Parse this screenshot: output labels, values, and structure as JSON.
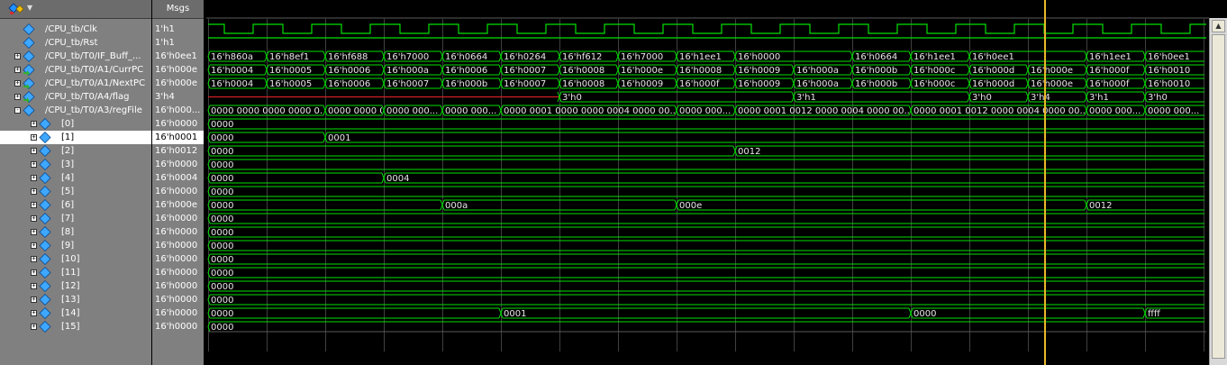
{
  "header": {
    "values_title": "Msgs"
  },
  "signals": [
    {
      "name": "/CPU_tb/Clk",
      "value": "1'h1",
      "indent": 0,
      "expander": "",
      "icon": "input"
    },
    {
      "name": "/CPU_tb/Rst",
      "value": "1'h1",
      "indent": 0,
      "expander": "",
      "icon": "input"
    },
    {
      "name": "/CPU_tb/T0/IF_Buff_...",
      "value": "16'h0ee1",
      "indent": 0,
      "expander": "+",
      "icon": "signal"
    },
    {
      "name": "/CPU_tb/T0/A1/CurrPC",
      "value": "16'h000e",
      "indent": 0,
      "expander": "+",
      "icon": "output"
    },
    {
      "name": "/CPU_tb/T0/A1/NextPC",
      "value": "16'h000e",
      "indent": 0,
      "expander": "+",
      "icon": "output"
    },
    {
      "name": "/CPU_tb/T0/A4/flag",
      "value": "3'h4",
      "indent": 0,
      "expander": "+",
      "icon": "output"
    },
    {
      "name": "/CPU_tb/T0/A3/regFile",
      "value": "16'h000...",
      "indent": 0,
      "expander": "-",
      "icon": "signal"
    },
    {
      "name": "[0]",
      "value": "16'h0000",
      "indent": 1,
      "expander": "+",
      "icon": "signal"
    },
    {
      "name": "[1]",
      "value": "16'h0001",
      "indent": 1,
      "expander": "+",
      "icon": "signal",
      "selected": true
    },
    {
      "name": "[2]",
      "value": "16'h0012",
      "indent": 1,
      "expander": "+",
      "icon": "signal"
    },
    {
      "name": "[3]",
      "value": "16'h0000",
      "indent": 1,
      "expander": "+",
      "icon": "signal"
    },
    {
      "name": "[4]",
      "value": "16'h0004",
      "indent": 1,
      "expander": "+",
      "icon": "signal"
    },
    {
      "name": "[5]",
      "value": "16'h0000",
      "indent": 1,
      "expander": "+",
      "icon": "signal"
    },
    {
      "name": "[6]",
      "value": "16'h000e",
      "indent": 1,
      "expander": "+",
      "icon": "signal"
    },
    {
      "name": "[7]",
      "value": "16'h0000",
      "indent": 1,
      "expander": "+",
      "icon": "signal"
    },
    {
      "name": "[8]",
      "value": "16'h0000",
      "indent": 1,
      "expander": "+",
      "icon": "signal"
    },
    {
      "name": "[9]",
      "value": "16'h0000",
      "indent": 1,
      "expander": "+",
      "icon": "signal"
    },
    {
      "name": "[10]",
      "value": "16'h0000",
      "indent": 1,
      "expander": "+",
      "icon": "signal"
    },
    {
      "name": "[11]",
      "value": "16'h0000",
      "indent": 1,
      "expander": "+",
      "icon": "signal"
    },
    {
      "name": "[12]",
      "value": "16'h0000",
      "indent": 1,
      "expander": "+",
      "icon": "signal"
    },
    {
      "name": "[13]",
      "value": "16'h0000",
      "indent": 1,
      "expander": "+",
      "icon": "signal"
    },
    {
      "name": "[14]",
      "value": "16'h0000",
      "indent": 1,
      "expander": "+",
      "icon": "signal"
    },
    {
      "name": "[15]",
      "value": "16'h0000",
      "indent": 1,
      "expander": "+",
      "icon": "signal"
    }
  ],
  "waves": {
    "clock_period": 65,
    "clk_edges": [
      0,
      18,
      50,
      83,
      115,
      148,
      180,
      213,
      245,
      278,
      310,
      343,
      375,
      408,
      440,
      473,
      505,
      538,
      570,
      603,
      635,
      668,
      700,
      733,
      765,
      798,
      830,
      863,
      895,
      928,
      960,
      993,
      1025,
      1058,
      1090
    ],
    "rst_level": "high",
    "cursor_time": 929,
    "buses": [
      {
        "row": 2,
        "segments": [
          [
            0,
            "16'h860a"
          ],
          [
            65,
            "16'h8ef1"
          ],
          [
            130,
            "16'hf688"
          ],
          [
            195,
            "16'h7000"
          ],
          [
            260,
            "16'h0664"
          ],
          [
            325,
            "16'h0264"
          ],
          [
            390,
            "16'hf612"
          ],
          [
            455,
            "16'h7000"
          ],
          [
            520,
            "16'h1ee1"
          ],
          [
            585,
            "16'h0000"
          ],
          [
            715,
            "16'h0664"
          ],
          [
            780,
            "16'h1ee1"
          ],
          [
            845,
            "16'h0ee1"
          ],
          [
            975,
            "16'h1ee1"
          ],
          [
            1040,
            "16'h0ee1"
          ]
        ]
      },
      {
        "row": 3,
        "segments": [
          [
            0,
            "16'h0004"
          ],
          [
            65,
            "16'h0005"
          ],
          [
            130,
            "16'h0006"
          ],
          [
            195,
            "16'h000a"
          ],
          [
            260,
            "16'h0006"
          ],
          [
            325,
            "16'h0007"
          ],
          [
            390,
            "16'h0008"
          ],
          [
            455,
            "16'h000e"
          ],
          [
            520,
            "16'h0008"
          ],
          [
            585,
            "16'h0009"
          ],
          [
            650,
            "16'h000a"
          ],
          [
            715,
            "16'h000b"
          ],
          [
            780,
            "16'h000c"
          ],
          [
            845,
            "16'h000d"
          ],
          [
            910,
            "16'h000e"
          ],
          [
            975,
            "16'h000f"
          ],
          [
            1040,
            "16'h0010"
          ]
        ]
      },
      {
        "row": 4,
        "segments": [
          [
            0,
            "16'h0004"
          ],
          [
            65,
            "16'h0005"
          ],
          [
            130,
            "16'h0006"
          ],
          [
            195,
            "16'h0007"
          ],
          [
            260,
            "16'h000b"
          ],
          [
            325,
            "16'h0007"
          ],
          [
            390,
            "16'h0008"
          ],
          [
            455,
            "16'h0009"
          ],
          [
            520,
            "16'h000f"
          ],
          [
            585,
            "16'h0009"
          ],
          [
            650,
            "16'h000a"
          ],
          [
            715,
            "16'h000b"
          ],
          [
            780,
            "16'h000c"
          ],
          [
            845,
            "16'h000d"
          ],
          [
            910,
            "16'h000e"
          ],
          [
            975,
            "16'h000f"
          ],
          [
            1040,
            "16'h0010"
          ]
        ]
      },
      {
        "row": 5,
        "undefined_until": 390,
        "segments": [
          [
            390,
            "3'h0"
          ],
          [
            650,
            "3'h1"
          ],
          [
            845,
            "3'h0"
          ],
          [
            910,
            "3'h4"
          ],
          [
            975,
            "3'h1"
          ],
          [
            1040,
            "3'h0"
          ]
        ]
      },
      {
        "row": 6,
        "segments": [
          [
            0,
            "0000 0000 0000 0000 0..."
          ],
          [
            130,
            "0000 0000 0..."
          ],
          [
            195,
            "0000 000..."
          ],
          [
            260,
            "0000 000..."
          ],
          [
            325,
            "0000 0001 0000 0000 0004 0000 00..."
          ],
          [
            520,
            "0000 000..."
          ],
          [
            585,
            "0000 0001 0012 0000 0004 0000 00..."
          ],
          [
            780,
            "0000 0001 0012 0000 0004 0000 00..."
          ],
          [
            975,
            "0000 000..."
          ],
          [
            1040,
            "0000 000..."
          ]
        ]
      },
      {
        "row": 7,
        "segments": [
          [
            0,
            "0000"
          ]
        ]
      },
      {
        "row": 8,
        "segments": [
          [
            0,
            "0000"
          ],
          [
            130,
            "0001"
          ]
        ]
      },
      {
        "row": 9,
        "segments": [
          [
            0,
            "0000"
          ],
          [
            585,
            "0012"
          ]
        ]
      },
      {
        "row": 10,
        "segments": [
          [
            0,
            "0000"
          ]
        ]
      },
      {
        "row": 11,
        "segments": [
          [
            0,
            "0000"
          ],
          [
            195,
            "0004"
          ]
        ]
      },
      {
        "row": 12,
        "segments": [
          [
            0,
            "0000"
          ]
        ]
      },
      {
        "row": 13,
        "segments": [
          [
            0,
            "0000"
          ],
          [
            260,
            "000a"
          ],
          [
            520,
            "000e"
          ],
          [
            975,
            "0012"
          ]
        ]
      },
      {
        "row": 14,
        "segments": [
          [
            0,
            "0000"
          ]
        ]
      },
      {
        "row": 15,
        "segments": [
          [
            0,
            "0000"
          ]
        ]
      },
      {
        "row": 16,
        "segments": [
          [
            0,
            "0000"
          ]
        ]
      },
      {
        "row": 17,
        "segments": [
          [
            0,
            "0000"
          ]
        ]
      },
      {
        "row": 18,
        "segments": [
          [
            0,
            "0000"
          ]
        ]
      },
      {
        "row": 19,
        "segments": [
          [
            0,
            "0000"
          ]
        ]
      },
      {
        "row": 20,
        "segments": [
          [
            0,
            "0000"
          ]
        ]
      },
      {
        "row": 21,
        "segments": [
          [
            0,
            "0000"
          ],
          [
            325,
            "0001"
          ],
          [
            780,
            "0000"
          ],
          [
            1040,
            "ffff"
          ]
        ]
      },
      {
        "row": 22,
        "segments": [
          [
            0,
            "0000"
          ]
        ]
      }
    ]
  },
  "colors": {
    "wave": "#00e000",
    "cursor": "#e8b828",
    "undefined": "#d02020",
    "grid": "#404040"
  }
}
